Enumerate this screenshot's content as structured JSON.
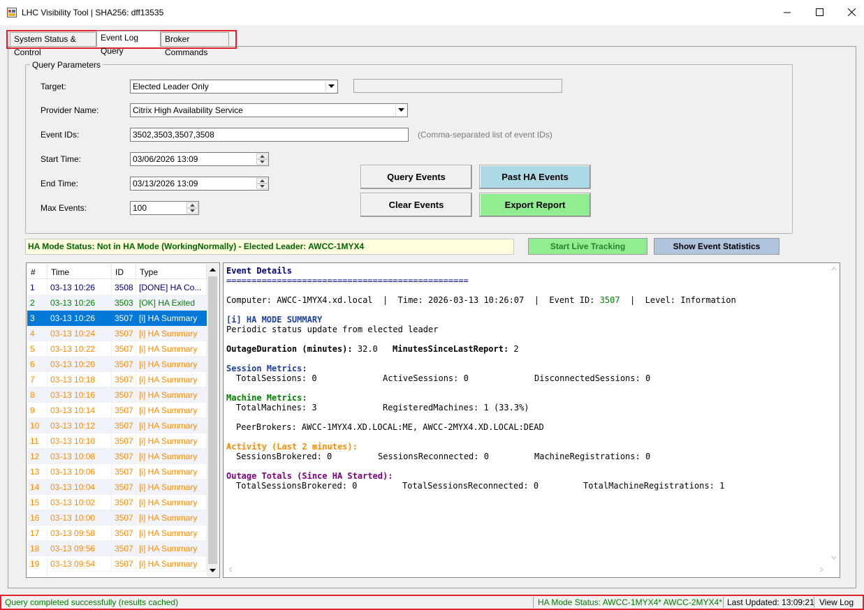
{
  "window": {
    "title": "LHC Visibility Tool | SHA256: dff13535"
  },
  "tabs": [
    {
      "label": "System Status & Control"
    },
    {
      "label": "Event Log Query"
    },
    {
      "label": "Broker Commands"
    }
  ],
  "query": {
    "legend": "Query Parameters",
    "target_label": "Target:",
    "target_value": "Elected Leader Only",
    "provider_label": "Provider Name:",
    "provider_value": "Citrix High Availability Service",
    "event_ids_label": "Event IDs:",
    "event_ids_value": "3502,3503,3507,3508",
    "event_ids_hint": "(Comma-separated list of event IDs)",
    "start_label": "Start Time:",
    "start_value": "03/06/2026 13:09",
    "end_label": "End Time:",
    "end_value": "03/13/2026 13:09",
    "max_label": "Max Events:",
    "max_value": "100"
  },
  "buttons": {
    "query_events": "Query Events",
    "past_ha_events": "Past HA Events",
    "clear_events": "Clear Events",
    "export_report": "Export Report",
    "start_live_tracking": "Start Live Tracking",
    "show_event_statistics": "Show Event Statistics"
  },
  "ha_status": "HA Mode Status: Not in HA Mode (WorkingNormally) - Elected Leader: AWCC-1MYX4",
  "list": {
    "columns": [
      "#",
      "Time",
      "ID",
      "Type"
    ],
    "rows": [
      {
        "n": "1",
        "time": "03-13 10:26",
        "id": "3508",
        "type": "[DONE] HA Co..."
      },
      {
        "n": "2",
        "time": "03-13 10:26",
        "id": "3503",
        "type": "[OK] HA Exited"
      },
      {
        "n": "3",
        "time": "03-13 10:26",
        "id": "3507",
        "type": "[i] HA Summary"
      },
      {
        "n": "4",
        "time": "03-13 10:24",
        "id": "3507",
        "type": "[i] HA Summary"
      },
      {
        "n": "5",
        "time": "03-13 10:22",
        "id": "3507",
        "type": "[i] HA Summary"
      },
      {
        "n": "6",
        "time": "03-13 10:20",
        "id": "3507",
        "type": "[i] HA Summary"
      },
      {
        "n": "7",
        "time": "03-13 10:18",
        "id": "3507",
        "type": "[i] HA Summary"
      },
      {
        "n": "8",
        "time": "03-13 10:16",
        "id": "3507",
        "type": "[i] HA Summary"
      },
      {
        "n": "9",
        "time": "03-13 10:14",
        "id": "3507",
        "type": "[i] HA Summary"
      },
      {
        "n": "10",
        "time": "03-13 10:12",
        "id": "3507",
        "type": "[i] HA Summary"
      },
      {
        "n": "11",
        "time": "03-13 10:10",
        "id": "3507",
        "type": "[i] HA Summary"
      },
      {
        "n": "12",
        "time": "03-13 10:08",
        "id": "3507",
        "type": "[i] HA Summary"
      },
      {
        "n": "13",
        "time": "03-13 10:06",
        "id": "3507",
        "type": "[i] HA Summary"
      },
      {
        "n": "14",
        "time": "03-13 10:04",
        "id": "3507",
        "type": "[i] HA Summary"
      },
      {
        "n": "15",
        "time": "03-13 10:02",
        "id": "3507",
        "type": "[i] HA Summary"
      },
      {
        "n": "16",
        "time": "03-13 10:00",
        "id": "3507",
        "type": "[i] HA Summary"
      },
      {
        "n": "17",
        "time": "03-13 09:58",
        "id": "3507",
        "type": "[i] HA Summary"
      },
      {
        "n": "18",
        "time": "03-13 09:56",
        "id": "3507",
        "type": "[i] HA Summary"
      },
      {
        "n": "19",
        "time": "03-13 09:54",
        "id": "3507",
        "type": "[i] HA Summary"
      }
    ],
    "row_colors": [
      "#000080",
      "#008000",
      "#ffffff",
      "#ff8c00"
    ]
  },
  "details": {
    "header": "Event Details",
    "rule": "================================================",
    "computer_line": "Computer: AWCC-1MYX4.xd.local  |  Time: 2026-03-13 10:26:07  |  Event ID: ",
    "event_id": "3507",
    "level_line": "  |  Level: Information",
    "mode_title": "[i] HA MODE SUMMARY",
    "mode_desc": "Periodic status update from elected leader",
    "outage_label": "OutageDuration (minutes):",
    "outage_value": " 32.0",
    "since_label": "MinutesSinceLastReport:",
    "since_value": " 2",
    "session_title": "Session Metrics:",
    "total_sessions": "TotalSessions: 0",
    "active_sessions": "ActiveSessions: 0",
    "disconnected_sessions": "DisconnectedSessions: 0",
    "machine_title": "Machine Metrics:",
    "total_machines": "TotalMachines: 3",
    "registered_machines": "RegisteredMachines: 1 (33.3%)",
    "peer_brokers": "PeerBrokers: AWCC-1MYX4.XD.LOCAL:ME, AWCC-2MYX4.XD.LOCAL:DEAD",
    "activity_title": "Activity (Last 2 minutes):",
    "sessions_brokered": "SessionsBrokered: 0",
    "sessions_reconnected": "SessionsReconnected: 0",
    "machine_registrations": "MachineRegistrations: 0",
    "totals_title": "Outage Totals (Since HA Started):",
    "total_sessions_brokered": "TotalSessionsBrokered: 0",
    "total_sessions_reconnected": "TotalSessionsReconnected: 0",
    "total_machine_registrations": "TotalMachineRegistrations: 1"
  },
  "statusbar": {
    "message": "Query completed successfully (results cached)",
    "ha_mode": "HA Mode Status: AWCC-1MYX4* AWCC-2MYX4*",
    "last_updated": "Last Updated: 13:09:21",
    "view_log": "View Log"
  },
  "colors": {
    "accent_highlight": "#e0202b",
    "past_ha_bg": "#add8e6",
    "export_bg": "#90ee90",
    "live_bg": "#90ee90",
    "stats_bg": "#b0c4de",
    "selection": "#0078d7"
  },
  "icons": {
    "app": "app-window-icon",
    "minimize": "minimize-icon",
    "maximize": "maximize-icon",
    "close": "close-icon"
  }
}
